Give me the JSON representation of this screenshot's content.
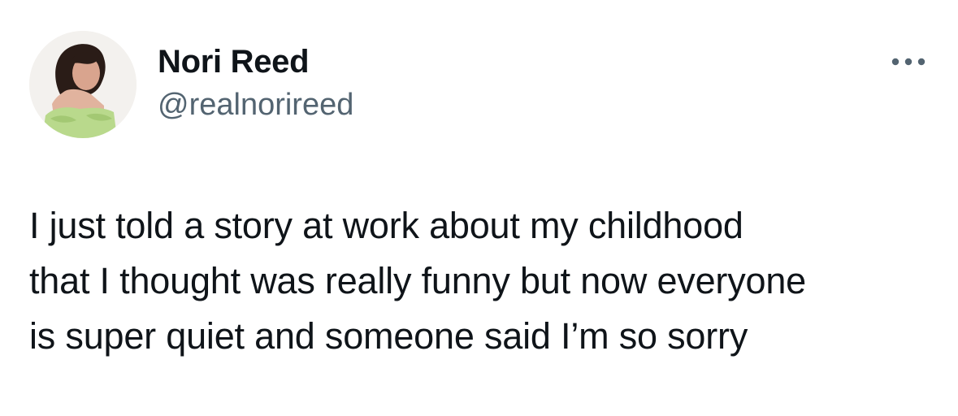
{
  "author": {
    "display_name": "Nori Reed",
    "handle": "@realnorireed",
    "avatar_icon": "profile-photo"
  },
  "menu": {
    "icon": "more-horizontal-icon"
  },
  "tweet": {
    "lines": [
      "I just told a story at work about my childhood",
      "that I thought was really funny but now everyone",
      "is super quiet and someone said I’m so sorry"
    ]
  },
  "colors": {
    "text_primary": "#0f1419",
    "text_secondary": "#536471",
    "background": "#ffffff"
  }
}
